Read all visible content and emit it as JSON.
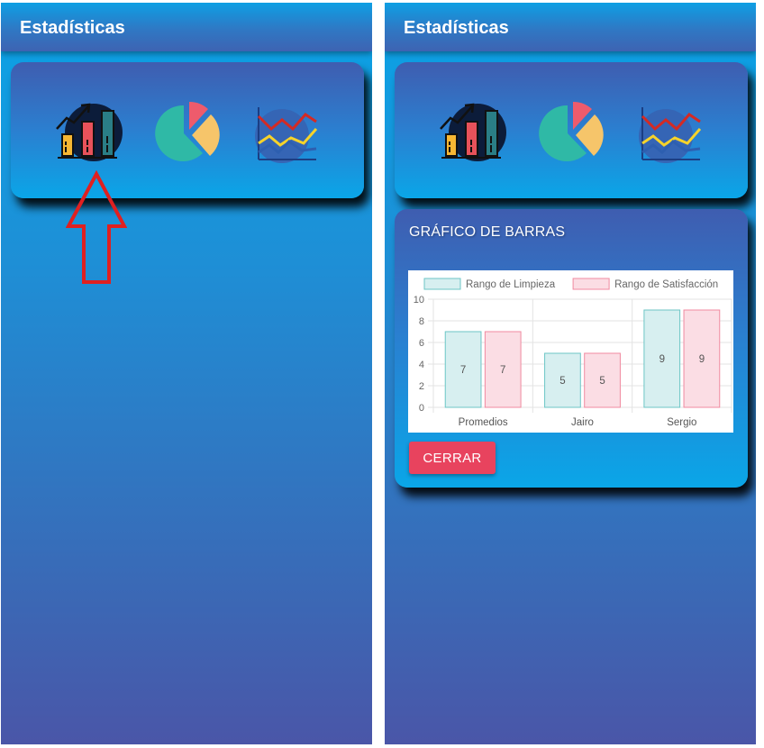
{
  "screens": [
    {
      "header": {
        "title": "Estadísticas"
      },
      "icons": [
        "bar-chart-icon",
        "pie-chart-icon",
        "line-chart-icon"
      ],
      "annotation": "up-arrow-pointer"
    },
    {
      "header": {
        "title": "Estadísticas"
      },
      "icons": [
        "bar-chart-icon",
        "pie-chart-icon",
        "line-chart-icon"
      ],
      "chart_card": {
        "title": "GRÁFICO DE BARRAS",
        "close_label": "CERRAR"
      }
    }
  ],
  "colors": {
    "accent_close": "#e8435e",
    "series_limpieza_fill": "#d7eff0",
    "series_limpieza_stroke": "#6cc6c6",
    "series_satisfaccion_fill": "#fbdde4",
    "series_satisfaccion_stroke": "#f08aa0"
  },
  "chart_data": {
    "type": "bar",
    "categories": [
      "Promedios",
      "Jairo",
      "Sergio"
    ],
    "series": [
      {
        "name": "Rango de Limpieza",
        "values": [
          7,
          5,
          9
        ]
      },
      {
        "name": "Rango de Satisfacción",
        "values": [
          7,
          5,
          9
        ]
      }
    ],
    "ylim": [
      0,
      10
    ],
    "yticks": [
      0,
      2,
      4,
      6,
      8,
      10
    ],
    "legend": "top",
    "grid": true,
    "data_labels": true
  }
}
